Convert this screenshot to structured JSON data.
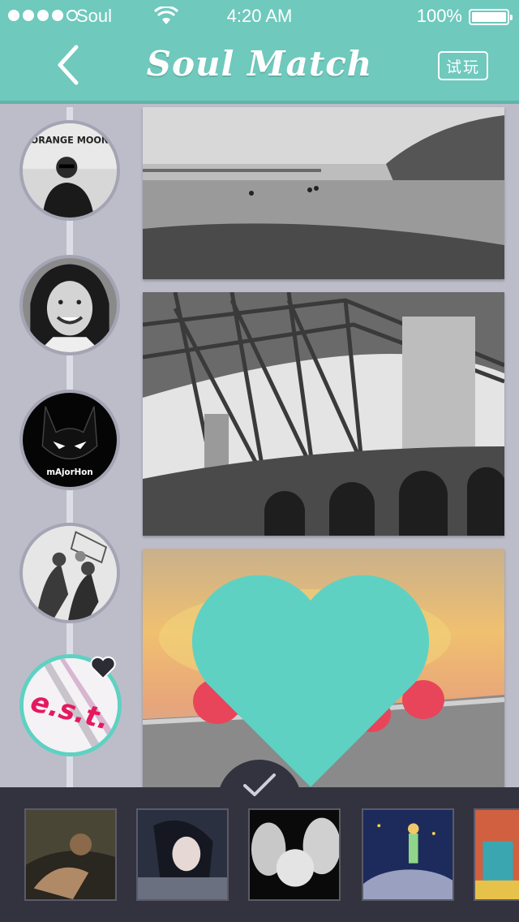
{
  "status_bar": {
    "carrier": "Soul",
    "time": "4:20 AM",
    "battery": "100%"
  },
  "nav": {
    "title": "Soul Match",
    "try_button": "试玩",
    "back_icon": "chevron-left-icon"
  },
  "timeline": {
    "avatars": [
      {
        "name": "avatar-orange-moon",
        "caption": "ORANGE MOON"
      },
      {
        "name": "avatar-smiling-woman"
      },
      {
        "name": "avatar-cat-mask",
        "caption": "mAjorHon"
      },
      {
        "name": "avatar-basketball"
      },
      {
        "name": "avatar-est",
        "caption": "e.s.t.",
        "liked": true
      }
    ]
  },
  "photos": [
    {
      "name": "photo-beach-pier"
    },
    {
      "name": "photo-bridge-lighthouse"
    },
    {
      "name": "photo-raspberries",
      "liked": true
    }
  ],
  "tray": {
    "confirm_icon": "checkmark-icon",
    "thumbnails": [
      "thumb-anime-couple",
      "thumb-anime-girl",
      "thumb-family-baby",
      "thumb-little-prince",
      "thumb-colorful-room"
    ]
  },
  "colors": {
    "accent": "#6fc9bd",
    "active_ring": "#5fd1c3",
    "tray_bg": "#333340",
    "background": "#bdbdc9"
  }
}
